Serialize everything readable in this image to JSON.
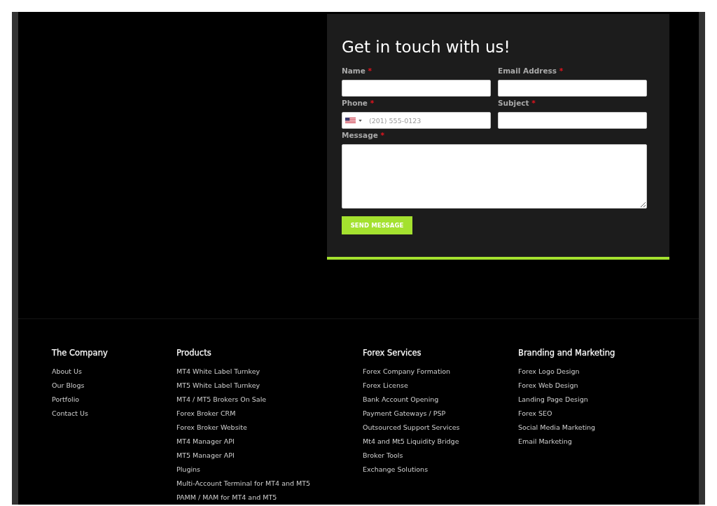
{
  "contact_form": {
    "title": "Get in touch with us!",
    "fields": [
      {
        "label": "Name",
        "required_mark": "*",
        "kind": "text"
      },
      {
        "label": "Email Address",
        "required_mark": "*",
        "kind": "text"
      },
      {
        "label": "Phone",
        "required_mark": "*",
        "kind": "phone",
        "placeholder": "(201) 555-0123"
      },
      {
        "label": "Subject",
        "required_mark": "*",
        "kind": "text"
      },
      {
        "label": "Message",
        "required_mark": "*",
        "kind": "textarea"
      }
    ],
    "submit_button": "SEND MESSAGE"
  },
  "footer": {
    "columns": [
      {
        "heading": "The Company",
        "links": [
          "About Us",
          "Our Blogs",
          "Portfolio",
          "Contact Us"
        ]
      },
      {
        "heading": "Products",
        "links": [
          "MT4 White Label Turnkey",
          "MT5 White Label Turnkey",
          "MT4 / MT5 Brokers On Sale",
          "Forex Broker CRM",
          "Forex Broker Website",
          "MT4 Manager API",
          "MT5 Manager API",
          "Plugins",
          "Multi-Account Terminal for MT4 and MT5",
          "PAMM / MAM for MT4 and MT5"
        ]
      },
      {
        "heading": "Forex Services",
        "links": [
          "Forex Company Formation",
          "Forex License",
          "Bank Account Opening",
          "Payment Gateways / PSP",
          "Outsourced Support Services",
          "Mt4 and Mt5 Liquidity Bridge",
          "Broker Tools",
          "Exchange Solutions"
        ]
      },
      {
        "heading": "Branding and Marketing",
        "links": [
          "Forex Logo Design",
          "Forex Web Design",
          "Landing Page Design",
          "Forex SEO",
          "Social Media Marketing",
          "Email Marketing"
        ]
      }
    ]
  }
}
